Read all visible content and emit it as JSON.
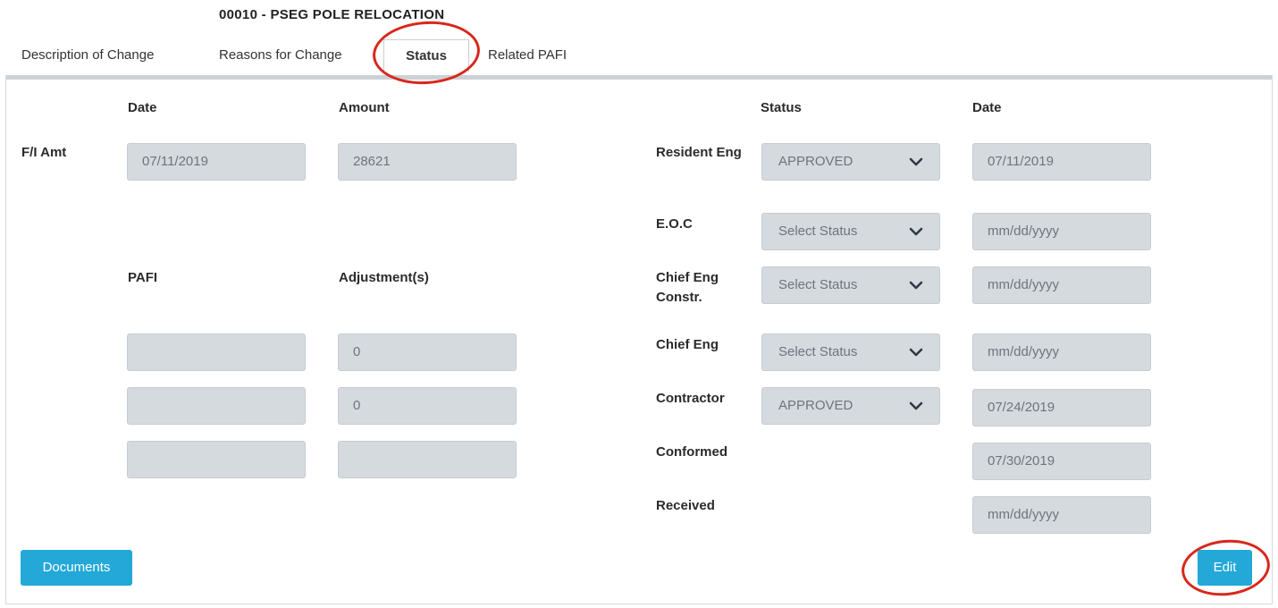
{
  "title": "00010 - PSEG POLE RELOCATION",
  "tabs": [
    {
      "label": "Description of Change"
    },
    {
      "label": "Reasons for Change"
    },
    {
      "label": "Status"
    },
    {
      "label": "Related PAFI"
    }
  ],
  "left": {
    "headers": {
      "date": "Date",
      "amount": "Amount",
      "pafi": "PAFI",
      "adjustments": "Adjustment(s)"
    },
    "fi_label": "F/I Amt",
    "fi_date": "07/11/2019",
    "fi_amount": "28621",
    "rows": [
      {
        "pafi": "",
        "adjustment": "0"
      },
      {
        "pafi": "",
        "adjustment": "0"
      },
      {
        "pafi": "",
        "adjustment": ""
      }
    ]
  },
  "right": {
    "headers": {
      "status": "Status",
      "date": "Date"
    },
    "rows": [
      {
        "label": "Resident Eng",
        "status": "APPROVED",
        "date": "07/11/2019"
      },
      {
        "label": "E.O.C",
        "status": "Select Status",
        "date": "",
        "placeholder": "mm/dd/yyyy"
      },
      {
        "label": "Chief Eng Constr.",
        "status": "Select Status",
        "date": "",
        "placeholder": "mm/dd/yyyy"
      },
      {
        "label": "Chief Eng",
        "status": "Select Status",
        "date": "",
        "placeholder": "mm/dd/yyyy"
      },
      {
        "label": "Contractor",
        "status": "APPROVED",
        "date": "07/24/2019"
      },
      {
        "label": "Conformed",
        "date": "07/30/2019"
      },
      {
        "label": "Received",
        "date": "",
        "placeholder": "mm/dd/yyyy"
      }
    ]
  },
  "buttons": {
    "documents": "Documents",
    "edit": "Edit"
  },
  "colors": {
    "accent": "#23a8d8",
    "field_bg": "#d5dadf",
    "annotation": "#d9271c"
  }
}
